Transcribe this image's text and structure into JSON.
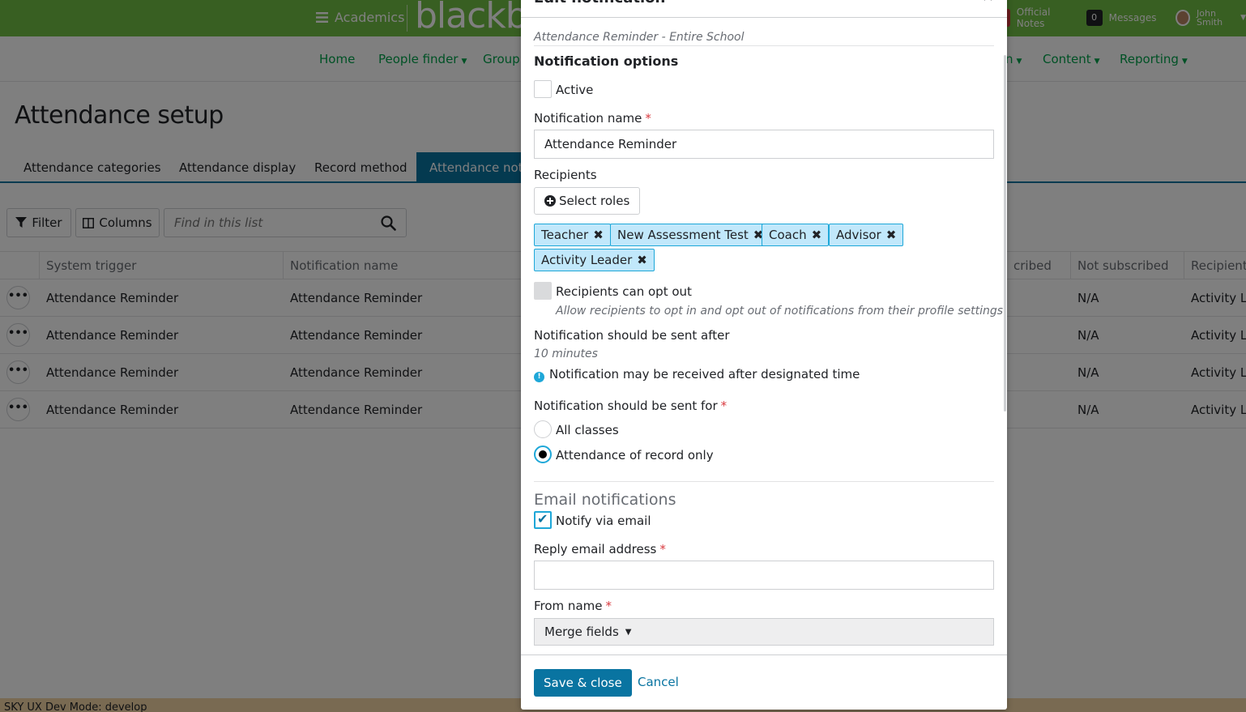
{
  "topbar": {
    "menu_label": "Academics",
    "logo_text": "blackb",
    "official_notes": "Official Notes",
    "messages_count": "0",
    "messages_label": "Messages",
    "user_first": "John",
    "user_last": "Smith"
  },
  "nav": {
    "items": [
      "Home",
      "People finder",
      "Group",
      "n",
      "Content",
      "Reporting"
    ]
  },
  "page": {
    "title": "Attendance setup",
    "tabs": [
      "Attendance categories",
      "Attendance display",
      "Record method",
      "Attendance noti"
    ]
  },
  "toolbar": {
    "filter_label": "Filter",
    "columns_label": "Columns",
    "search_placeholder": "Find in this list"
  },
  "grid": {
    "columns": [
      "System trigger",
      "Notification name",
      "cribed",
      "Not subscribed",
      "Recipients"
    ],
    "rows": [
      {
        "trigger": "Attendance Reminder",
        "name": "Attendance Reminder",
        "not_subscribed": "N/A",
        "recipients": "Activity Le"
      },
      {
        "trigger": "Attendance Reminder",
        "name": "Attendance Reminder",
        "not_subscribed": "N/A",
        "recipients": "Activity Le"
      },
      {
        "trigger": "Attendance Reminder",
        "name": "Attendance Reminder",
        "not_subscribed": "N/A",
        "recipients": "Activity Le"
      },
      {
        "trigger": "Attendance Reminder",
        "name": "Attendance Reminder",
        "not_subscribed": "N/A",
        "recipients": "Activity Le"
      }
    ]
  },
  "devbar": {
    "text": "SKY UX Dev Mode: develop"
  },
  "modal": {
    "title": "Edit notification",
    "subtitle": "Attendance Reminder - Entire School",
    "options_heading": "Notification options",
    "active_label": "Active",
    "name_label": "Notification name",
    "name_value": "Attendance Reminder",
    "recipients_label": "Recipients",
    "select_roles_label": "Select roles",
    "roles": [
      "Teacher",
      "New Assessment Test",
      "Coach",
      "Advisor",
      "Activity Leader"
    ],
    "optout_label": "Recipients can opt out",
    "optout_help": "Allow recipients to opt in and opt out of notifications from their profile settings",
    "sent_after_label": "Notification should be sent after",
    "sent_after_value": "10 minutes",
    "info_text": "Notification may be received after designated time",
    "sent_for_label": "Notification should be sent for",
    "radio_all": "All classes",
    "radio_record": "Attendance of record only",
    "email_heading": "Email notifications",
    "notify_email_label": "Notify via email",
    "reply_label": "Reply email address",
    "reply_value": "",
    "from_label": "From name",
    "merge_label": "Merge fields",
    "save_label": "Save & close",
    "cancel_label": "Cancel"
  },
  "colors": {
    "brand_green": "#71bf44",
    "primary_blue": "#0974a1",
    "token_bg": "#c1e8fb",
    "token_border": "#1ea7d8",
    "required_red": "#d93a3f"
  }
}
